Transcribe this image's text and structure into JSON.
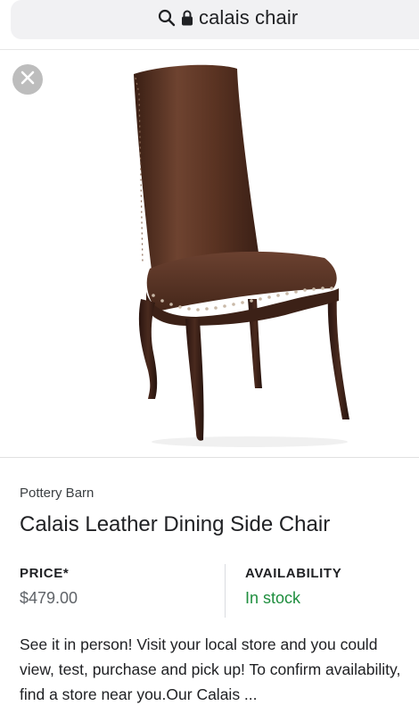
{
  "search": {
    "query": "calais chair"
  },
  "product": {
    "brand": "Pottery Barn",
    "title": "Calais Leather Dining Side Chair",
    "price_label": "PRICE*",
    "price_value": "$479.00",
    "availability_label": "AVAILABILITY",
    "availability_value": "In stock",
    "description": "See it in person! Visit your local store and you could view, test, purchase and pick up! To confirm availability, find a store near you.Our Calais ..."
  },
  "icons": {
    "search": "search-icon",
    "lock": "lock-icon",
    "close": "close-icon",
    "more": "more-options-icon"
  },
  "colors": {
    "in_stock": "#1e8e3e",
    "leather": "#5a3322",
    "search_bg": "#f1f1f3"
  }
}
